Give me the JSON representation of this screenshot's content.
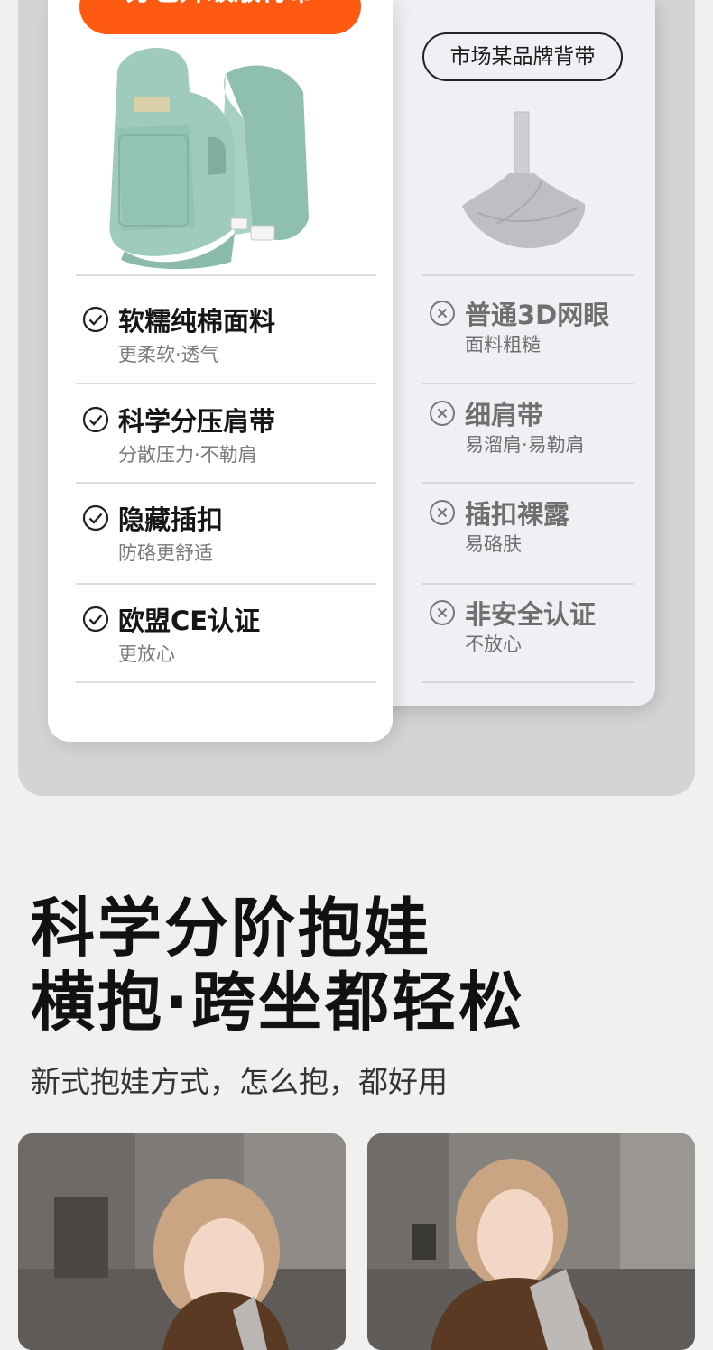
{
  "compare": {
    "ours": {
      "badge": "分也升级版背带",
      "product_image": "green baby carrier",
      "features": [
        {
          "title": "软糯纯棉面料",
          "sub": "更柔软·透气",
          "icon": "check-circle-icon"
        },
        {
          "title": "科学分压肩带",
          "sub": "分散压力·不勒肩",
          "icon": "check-circle-icon"
        },
        {
          "title": "隐藏插扣",
          "sub": "防硌更舒适",
          "icon": "check-circle-icon"
        },
        {
          "title": "欧盟CE认证",
          "sub": "更放心",
          "icon": "check-circle-icon"
        }
      ]
    },
    "other": {
      "badge": "市场某品牌背带",
      "product_image": "grey sling carrier",
      "features": [
        {
          "title": "普通3D网眼",
          "sub": "面料粗糙",
          "icon": "x-circle-icon"
        },
        {
          "title": "细肩带",
          "sub": "易溜肩·易勒肩",
          "icon": "x-circle-icon"
        },
        {
          "title": "插扣裸露",
          "sub": "易硌肤",
          "icon": "x-circle-icon"
        },
        {
          "title": "非安全认证",
          "sub": "不放心",
          "icon": "x-circle-icon"
        }
      ]
    }
  },
  "section": {
    "headline_line1": "科学分阶抱娃",
    "headline_line2": "横抱·跨坐都轻松",
    "subline": "新式抱娃方式，怎么抱，都好用"
  },
  "photos": [
    {
      "alt": "woman carrying baby in carrier - photo 1"
    },
    {
      "alt": "woman carrying baby in carrier - photo 2"
    }
  ],
  "colors": {
    "accent": "#ff5a12",
    "panel": "#d4d4d4",
    "page": "#f0f0f0"
  }
}
